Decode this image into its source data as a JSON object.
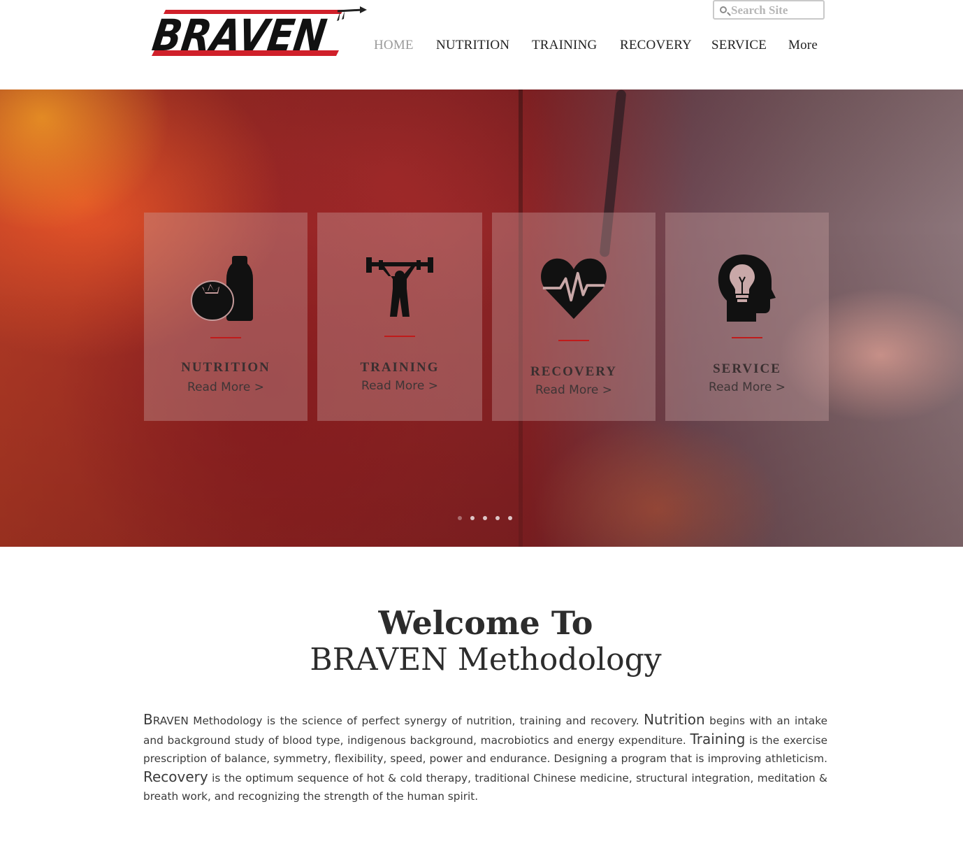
{
  "header": {
    "logo_text": "BRAVEN",
    "search_placeholder": "Search Site",
    "nav": [
      {
        "label": "HOME",
        "active": true
      },
      {
        "label": "NUTRITION",
        "active": false
      },
      {
        "label": "TRAINING",
        "active": false
      },
      {
        "label": "RECOVERY",
        "active": false
      },
      {
        "label": "SERVICE",
        "active": false
      },
      {
        "label": "More",
        "active": false
      }
    ]
  },
  "hero": {
    "cards": [
      {
        "title": "NUTRITION",
        "link": "Read More >",
        "icon": "tomato-bottle-icon"
      },
      {
        "title": "TRAINING",
        "link": "Read More >",
        "icon": "weightlifter-icon"
      },
      {
        "title": "RECOVERY",
        "link": "Read More >",
        "icon": "heartbeat-icon"
      },
      {
        "title": "SERVICE",
        "link": "Read More >",
        "icon": "head-lightbulb-icon"
      }
    ],
    "slide_count": 5,
    "active_slide": 1
  },
  "welcome": {
    "line1": "Welcome To",
    "line2": "BRAVEN Methodology",
    "paragraph": {
      "p1_cap": "B",
      "p1": "RAVEN Methodology is the science of perfect synergy of nutrition, training and recovery. ",
      "k1": "Nutrition",
      "p2": " begins with an intake and background study of blood type, indigenous background, macrobiotics and energy expenditure. ",
      "k2": "Training",
      "p3": " is the exercise prescription of balance, symmetry, flexibility, speed, power and endurance. Designing a program that is improving athleticism. ",
      "k3": "Recovery",
      "p4": " is the optimum sequence of hot & cold therapy, traditional Chinese medicine, structural integration, meditation & breath work, and recognizing the strength of the human spirit."
    }
  },
  "colors": {
    "accent_red": "#c01b1b",
    "text_dark": "#2c2c2c",
    "nav_active": "#9a9a9a"
  }
}
